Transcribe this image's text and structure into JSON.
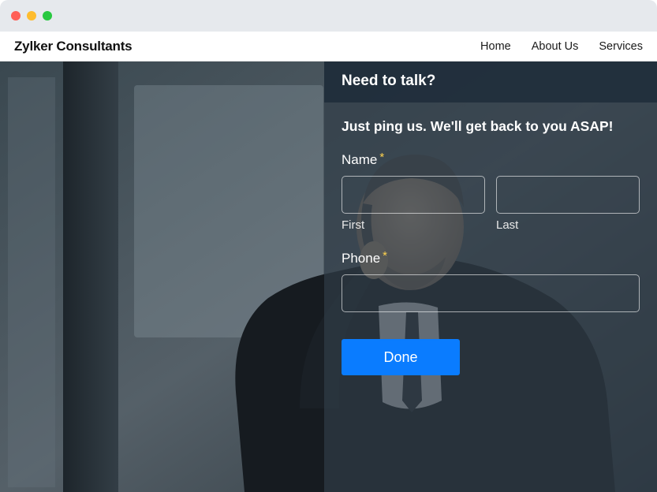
{
  "brand": "Zylker Consultants",
  "nav": {
    "items": [
      {
        "label": "Home"
      },
      {
        "label": "About Us"
      },
      {
        "label": "Services"
      }
    ]
  },
  "form": {
    "header": "Need to talk?",
    "subtitle": "Just ping us. We'll get back to you ASAP!",
    "name_label": "Name",
    "first_sublabel": "First",
    "last_sublabel": "Last",
    "phone_label": "Phone",
    "required_marker": "*",
    "submit_label": "Done"
  }
}
